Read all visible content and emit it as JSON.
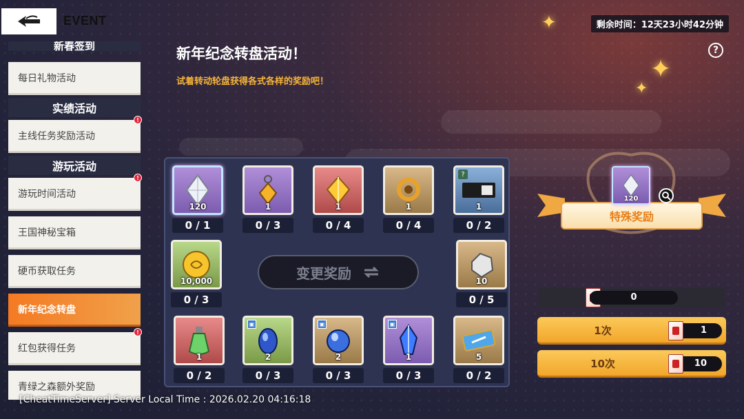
{
  "header": {
    "title": "EVENT",
    "timer": "剩余时间：12天23小时42分钟"
  },
  "sidebar": {
    "partial_header": "新春签到",
    "items": [
      {
        "label": "每日礼物活动",
        "badge": false,
        "active": false
      },
      {
        "label": "主线任务奖励活动",
        "badge": true,
        "active": false
      },
      {
        "label": "游玩时间活动",
        "badge": true,
        "active": false
      },
      {
        "label": "王国神秘宝箱",
        "badge": false,
        "active": false
      },
      {
        "label": "硬币获取任务",
        "badge": false,
        "active": false
      },
      {
        "label": "新年纪念转盘",
        "badge": false,
        "active": true
      },
      {
        "label": "红包获得任务",
        "badge": true,
        "active": false
      },
      {
        "label": "青绿之森额外奖励",
        "badge": false,
        "active": false
      }
    ],
    "sections": [
      "实绩活动",
      "游玩活动"
    ],
    "badge_mark": "!"
  },
  "main": {
    "title": "新年纪念转盘活动！",
    "subtitle": "试着转动轮盘获得各式各样的奖励吧！",
    "help_mark": "?"
  },
  "board": {
    "change_label": "变更奖励",
    "slots": [
      {
        "name": "crystal-120",
        "qty": "120",
        "count": "0 / 1",
        "color": "purple",
        "icon": "crystal-icon",
        "tag": ""
      },
      {
        "name": "gold-amulet",
        "qty": "1",
        "count": "0 / 3",
        "color": "purple",
        "icon": "amulet-icon",
        "tag": ""
      },
      {
        "name": "gold-crystal",
        "qty": "1",
        "count": "0 / 4",
        "color": "red",
        "icon": "gold-gem-icon",
        "tag": ""
      },
      {
        "name": "gold-ring",
        "qty": "1",
        "count": "0 / 4",
        "color": "gold",
        "icon": "ring-icon",
        "tag": ""
      },
      {
        "name": "mystery-ticket",
        "qty": "1",
        "count": "0 / 2",
        "color": "blue",
        "icon": "ticket-icon",
        "tag": "?"
      },
      {
        "name": "gold-coin",
        "qty": "10,000",
        "count": "0 / 3",
        "color": "green",
        "icon": "coin-icon",
        "tag": ""
      },
      {
        "name": "silver-ore",
        "qty": "10",
        "count": "0 / 5",
        "color": "gold",
        "icon": "ore-icon",
        "tag": ""
      },
      {
        "name": "green-potion",
        "qty": "1",
        "count": "0 / 2",
        "color": "red",
        "icon": "potion-icon",
        "tag": ""
      },
      {
        "name": "blue-stone-a",
        "qty": "2",
        "count": "0 / 3",
        "color": "green",
        "icon": "blue-stone-icon",
        "tag": "▣"
      },
      {
        "name": "blue-stone-b",
        "qty": "2",
        "count": "0 / 3",
        "color": "gold",
        "icon": "blue-stone-icon",
        "tag": "▣"
      },
      {
        "name": "blue-crystal",
        "qty": "1",
        "count": "0 / 3",
        "color": "purple",
        "icon": "blue-crystal-icon",
        "tag": "▣"
      },
      {
        "name": "blue-ticket",
        "qty": "5",
        "count": "0 / 2",
        "color": "gold",
        "icon": "sword-ticket-icon",
        "tag": ""
      }
    ]
  },
  "special": {
    "label": "特殊奖励",
    "qty": "120"
  },
  "tickets": {
    "owned": "0"
  },
  "spin": [
    {
      "label": "1次",
      "cost": "1"
    },
    {
      "label": "10次",
      "cost": "10"
    }
  ],
  "footer": {
    "server_time": "[CheatTimeServer] Server Local Time : 2026.02.20 04:16:18"
  }
}
